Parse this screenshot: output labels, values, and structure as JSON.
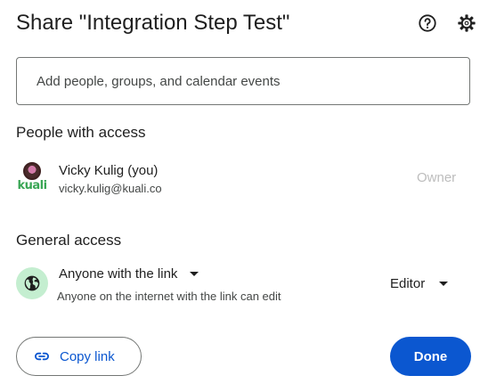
{
  "dialog": {
    "title": "Share \"Integration Step Test\""
  },
  "header_icons": {
    "help": "help-circle-icon",
    "settings": "gear-icon"
  },
  "share_input": {
    "placeholder": "Add people, groups, and calendar events",
    "value": ""
  },
  "people_section": {
    "title": "People with access",
    "people": [
      {
        "name": "Vicky Kulig (you)",
        "email": "vicky.kulig@kuali.co",
        "role": "Owner",
        "avatar_logo": "kuali"
      }
    ]
  },
  "general_access": {
    "title": "General access",
    "access_level": "Anyone with the link",
    "description": "Anyone on the internet with the link can edit",
    "role": "Editor",
    "icon": "globe-icon"
  },
  "footer": {
    "copy_link_label": "Copy link",
    "done_label": "Done"
  },
  "colors": {
    "accent": "#0b57d0",
    "globe_bg": "#c4eed0",
    "logo_green": "#3aa655"
  }
}
